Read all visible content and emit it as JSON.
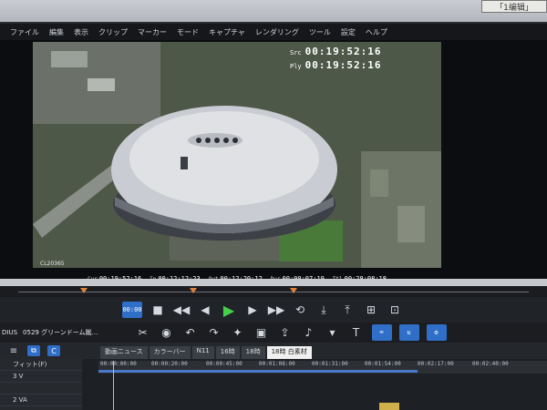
{
  "sticky": "「1编辑」",
  "menu": [
    "ファイル",
    "編集",
    "表示",
    "クリップ",
    "マーカー",
    "モード",
    "キャプチャ",
    "レンダリング",
    "ツール",
    "設定",
    "ヘルプ"
  ],
  "overlay": {
    "src_label": "Src",
    "src_tc": "00:19:52:16",
    "ply_label": "Ply",
    "ply_tc": "00:19:52:16"
  },
  "clip_id": "CL20365",
  "strip": {
    "cur_label": "Cur",
    "cur": "00:19:52;16",
    "in_label": "In",
    "in": "00:12:12;23",
    "out_label": "Out",
    "out": "00:12:20;12",
    "dur_label": "Dur",
    "dur": "00:00:07;19",
    "ttl_label": "Ttl",
    "ttl": "00:28:08;18"
  },
  "transport_tc_btn": "00:00",
  "project": {
    "app": "DIUS",
    "name": "0529 グリーンドーム蹴…"
  },
  "tabs": [
    "動画ニュース",
    "カラーバー",
    "N11",
    "16時",
    "18時",
    "18時 白素材"
  ],
  "active_tab": 5,
  "tracks": [
    "フィット(F)",
    "3 V",
    "",
    "2 VA"
  ],
  "ruler": [
    "00:00:00:00",
    "00:00:20:00",
    "00:00:45:00",
    "00:01:08:00",
    "00:01:31:00",
    "00:01:54:00",
    "00:02:17:00",
    "00:02:40:00"
  ]
}
